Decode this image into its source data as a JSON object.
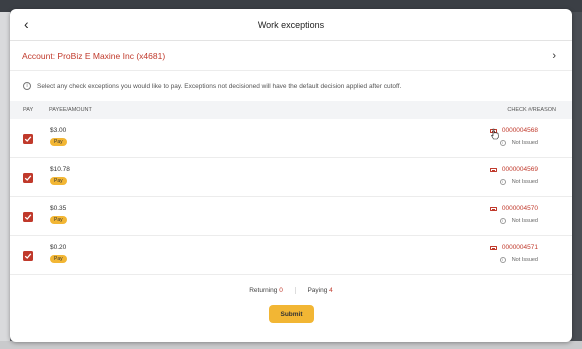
{
  "header": {
    "back_glyph": "‹",
    "title": "Work exceptions"
  },
  "account": {
    "label": "Account: ProBiz E Maxine Inc (x4681)",
    "chevron": "›"
  },
  "notice": {
    "icon": "info-icon",
    "text": "Select any check exceptions you would like to pay. Exceptions not decisioned will have the default decision applied after cutoff."
  },
  "table": {
    "columns": {
      "pay": "PAY",
      "payee_amount": "PAYEE/AMOUNT",
      "check_reason": "CHECK #/REASON"
    },
    "rows": [
      {
        "amount": "$3.00",
        "badge": "Pay",
        "check_number": "0000004568",
        "reason": "Not Issued",
        "checked": true
      },
      {
        "amount": "$10.78",
        "badge": "Pay",
        "check_number": "0000004569",
        "reason": "Not Issued",
        "checked": true
      },
      {
        "amount": "$0.35",
        "badge": "Pay",
        "check_number": "0000004570",
        "reason": "Not Issued",
        "checked": true
      },
      {
        "amount": "$0.20",
        "badge": "Pay",
        "check_number": "0000004571",
        "reason": "Not Issued",
        "checked": true
      }
    ]
  },
  "summary": {
    "returning_label": "Returning",
    "returning_count": "0",
    "paying_label": "Paying",
    "paying_count": "4"
  },
  "actions": {
    "submit_label": "Submit"
  },
  "colors": {
    "accent": "#c0392b",
    "button": "#f2b634"
  }
}
